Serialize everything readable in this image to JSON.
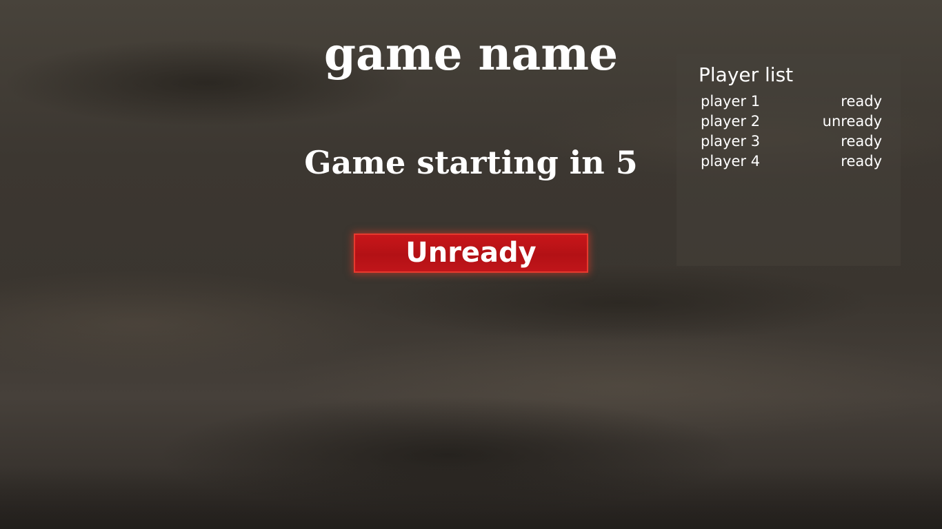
{
  "game": {
    "title": "game name",
    "countdown_text": "Game starting in 5",
    "ready_button_label": "Unready",
    "ready_button_color": "#c8161a"
  },
  "player_list": {
    "title": "Player list",
    "players": [
      {
        "name": "player 1",
        "status": "ready"
      },
      {
        "name": "player 2",
        "status": "unready"
      },
      {
        "name": "player 3",
        "status": "ready"
      },
      {
        "name": "player 4",
        "status": "ready"
      }
    ]
  }
}
